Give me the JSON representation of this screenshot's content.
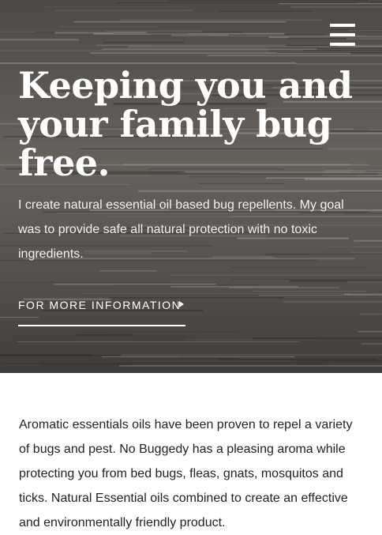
{
  "header": {
    "menu_icon": "hamburger-menu-icon"
  },
  "hero": {
    "headline": "Keeping you and your family bug free.",
    "intro": "I create natural essential oil based bug repellents. My goal was to provide safe all natural protection with no toxic ingredients.",
    "cta_label": "FOR MORE INFORMATION",
    "cta_icon": "triangle-right-icon"
  },
  "main": {
    "paragraph": "Aromatic essentials oils have been proven to repel a variety of bugs and pest. No Buggedy has a pleasing aroma while protecting you from bed bugs, fleas, gnats, mosquitos and ticks. Natural Essential oils combined to create an effective and environmentally friendly product."
  },
  "colors": {
    "hero_text": "#ffffff",
    "body_text": "#222222",
    "background": "#ffffff"
  }
}
